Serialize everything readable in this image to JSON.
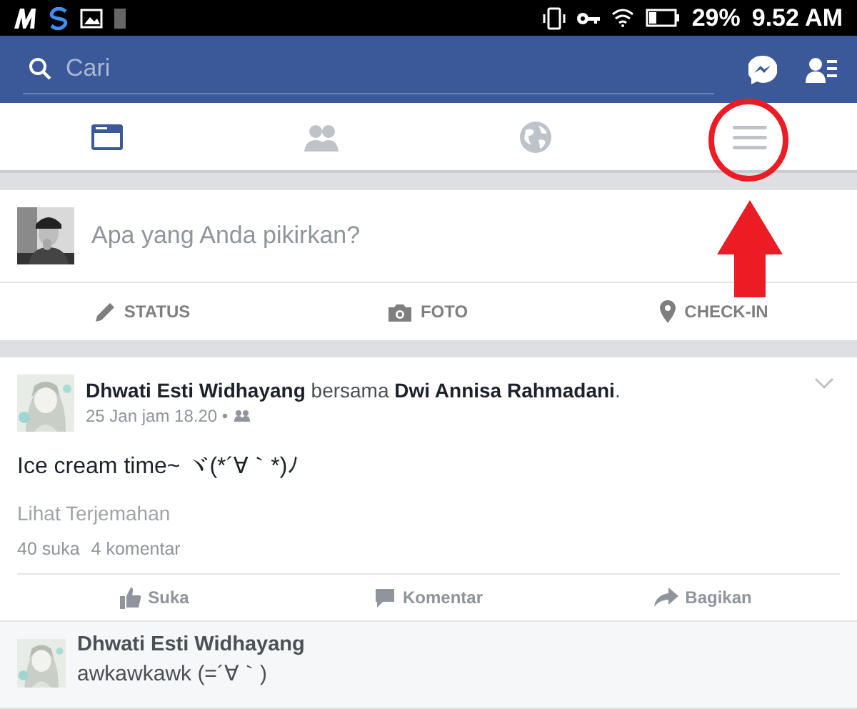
{
  "status_bar": {
    "battery": "29%",
    "time": "9.52 AM"
  },
  "search": {
    "placeholder": "Cari"
  },
  "tabs": [
    {
      "selected": true
    },
    {
      "selected": false
    },
    {
      "selected": false
    },
    {
      "selected": false
    }
  ],
  "composer": {
    "placeholder": "Apa yang Anda pikirkan?",
    "actions": [
      "STATUS",
      "FOTO",
      "CHECK-IN"
    ]
  },
  "post": {
    "header": "**Dhwati Esti Widhayang** bersama **Dwi Annisa Rahmadani**.",
    "time": "25 Jan jam 18.20 •",
    "text": "Ice cream time~ ヾ(*´∀｀*)ﾉ",
    "translate": "Lihat Terjemahan",
    "likes": "40 suka",
    "comments": "4 komentar",
    "actions": [
      "Suka",
      "Komentar",
      "Bagikan"
    ],
    "comment": {
      "author": "Dhwati Esti Widhayang",
      "text": "awkawkawk (=´∀｀)"
    }
  }
}
